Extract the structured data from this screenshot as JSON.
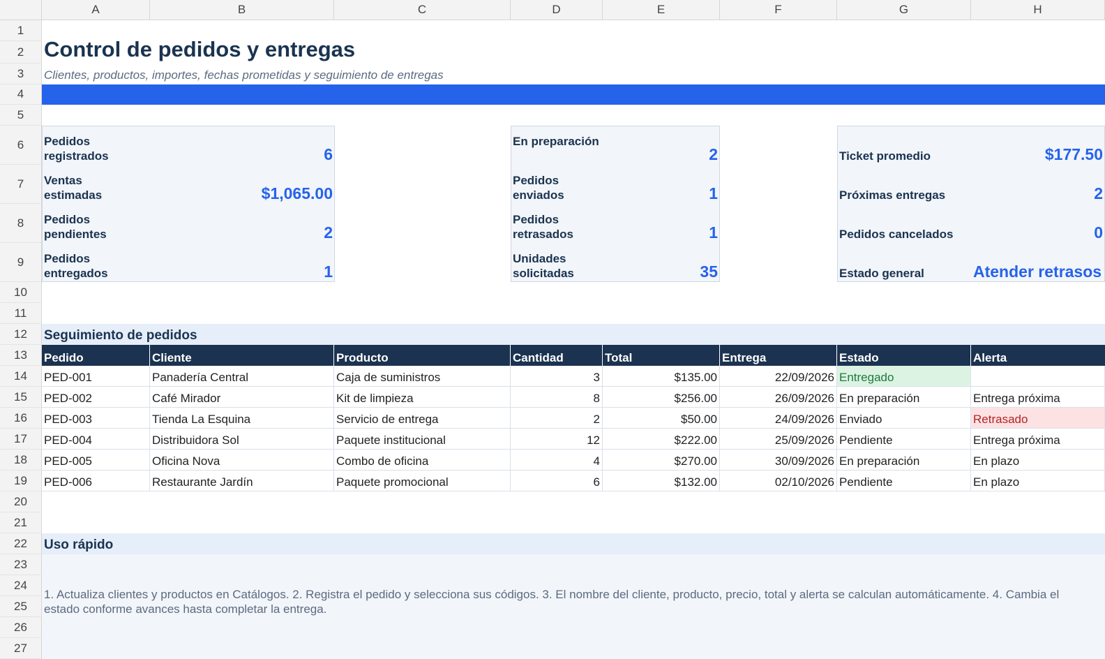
{
  "columns": [
    "A",
    "B",
    "C",
    "D",
    "E",
    "F",
    "G",
    "H"
  ],
  "rows": [
    "1",
    "2",
    "3",
    "4",
    "5",
    "6",
    "7",
    "8",
    "9",
    "10",
    "11",
    "12",
    "13",
    "14",
    "15",
    "16",
    "17",
    "18",
    "19",
    "20",
    "21",
    "22",
    "23",
    "24",
    "25",
    "26",
    "27"
  ],
  "title": "Control de pedidos y entregas",
  "subtitle": "Clientes, productos, importes, fechas prometidas y seguimiento de entregas",
  "accent_color": "#2563eb",
  "header_color": "#1b3350",
  "kpi_left": [
    {
      "label": "Pedidos registrados",
      "value": "6"
    },
    {
      "label": "Ventas estimadas",
      "value": "$1,065.00"
    },
    {
      "label": "Pedidos pendientes",
      "value": "2"
    },
    {
      "label": "Pedidos entregados",
      "value": "1"
    }
  ],
  "kpi_mid": [
    {
      "label": "En preparación",
      "value": "2"
    },
    {
      "label": "Pedidos enviados",
      "value": "1"
    },
    {
      "label": "Pedidos retrasados",
      "value": "1"
    },
    {
      "label": "Unidades solicitadas",
      "value": "35"
    }
  ],
  "kpi_right": [
    {
      "label": "Ticket promedio",
      "value": "$177.50"
    },
    {
      "label": "Próximas entregas",
      "value": "2"
    },
    {
      "label": "Pedidos cancelados",
      "value": "0"
    },
    {
      "label": "Estado general",
      "value": "Atender retrasos"
    }
  ],
  "orders_section": "Seguimiento de pedidos",
  "table_headers": [
    "Pedido",
    "Cliente",
    "Producto",
    "Cantidad",
    "Total",
    "Entrega",
    "Estado",
    "Alerta"
  ],
  "orders": [
    [
      "PED-001",
      "Panadería Central",
      "Caja de suministros",
      "3",
      "$135.00",
      "22/09/2026",
      "Entregado",
      ""
    ],
    [
      "PED-002",
      "Café Mirador",
      "Kit de limpieza",
      "8",
      "$256.00",
      "26/09/2026",
      "En preparación",
      "Entrega próxima"
    ],
    [
      "PED-003",
      "Tienda La Esquina",
      "Servicio de entrega",
      "2",
      "$50.00",
      "24/09/2026",
      "Enviado",
      "Retrasado"
    ],
    [
      "PED-004",
      "Distribuidora Sol",
      "Paquete institucional",
      "12",
      "$222.00",
      "25/09/2026",
      "Pendiente",
      "Entrega próxima"
    ],
    [
      "PED-005",
      "Oficina Nova",
      "Combo de oficina",
      "4",
      "$270.00",
      "30/09/2026",
      "En preparación",
      "En plazo"
    ],
    [
      "PED-006",
      "Restaurante Jardín",
      "Paquete promocional",
      "6",
      "$132.00",
      "02/10/2026",
      "Pendiente",
      "En plazo"
    ]
  ],
  "quick_section": "Uso rápido",
  "quick_note": "1. Actualiza clientes y productos en Catálogos.  2. Registra el pedido y selecciona sus códigos.  3. El nombre del cliente, producto, precio, total y alerta se calculan automáticamente.  4. Cambia el estado conforme avances hasta completar la entrega."
}
